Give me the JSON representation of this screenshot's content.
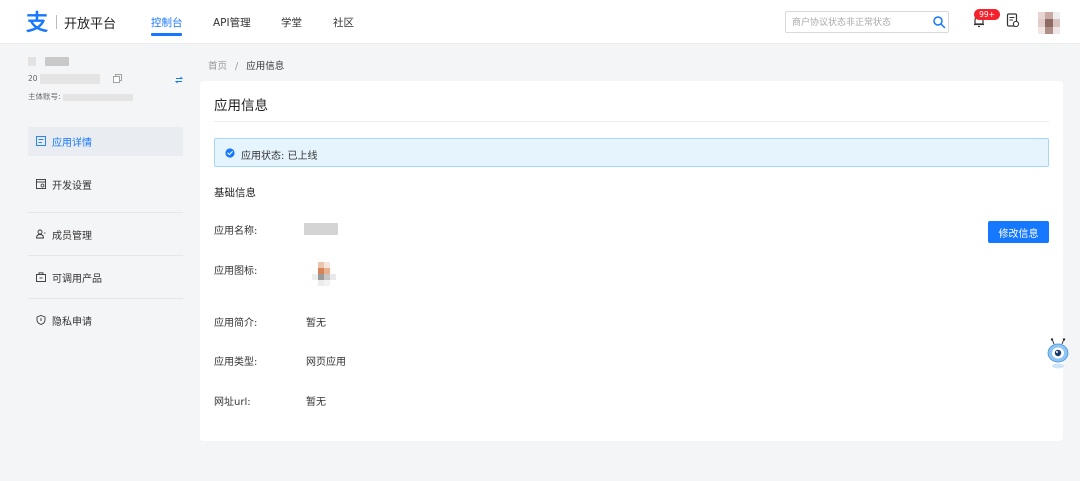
{
  "header": {
    "brand": "开放平台",
    "nav": [
      {
        "label": "控制台",
        "active": true
      },
      {
        "label": "API管理"
      },
      {
        "label": "学堂"
      },
      {
        "label": "社区"
      }
    ],
    "search_placeholder": "商户协议状态非正常状态",
    "notification_badge": "99+",
    "accent_color": "#1677ff",
    "badge_color": "#f5222d"
  },
  "sidebar": {
    "account_id_prefix": "20",
    "account_main_label": "主体账号:",
    "items": [
      {
        "label": "应用详情",
        "icon": "app-detail-icon",
        "active": true
      },
      {
        "label": "开发设置",
        "icon": "dev-settings-icon"
      },
      {
        "label": "成员管理",
        "icon": "members-icon"
      },
      {
        "label": "可调用产品",
        "icon": "products-icon"
      },
      {
        "label": "隐私申请",
        "icon": "privacy-icon"
      }
    ]
  },
  "breadcrumb": {
    "home": "首页",
    "separator": "/",
    "current": "应用信息"
  },
  "main": {
    "title": "应用信息",
    "status_text": "应用状态: 已上线",
    "section_title": "基础信息",
    "edit_button": "修改信息",
    "fields": [
      {
        "label": "应用名称:",
        "value": ""
      },
      {
        "label": "应用图标:",
        "value": ""
      },
      {
        "label": "应用简介:",
        "value": "暂无"
      },
      {
        "label": "应用类型:",
        "value": "网页应用"
      },
      {
        "label": "网址url:",
        "value": "暂无"
      }
    ]
  }
}
